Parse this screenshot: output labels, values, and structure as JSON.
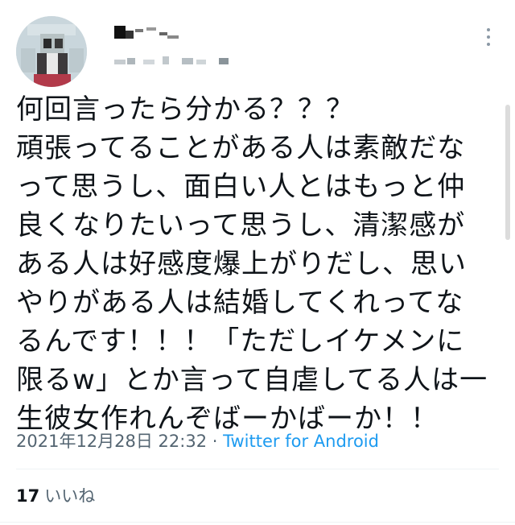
{
  "tweet": {
    "text": "何回言ったら分かる？？？\n頑張ってることがある人は素敵だなって思うし、面白い人とはもっと仲良くなりたいって思うし、清潔感がある人は好感度爆上がりだし、思いやりがある人は結婚してくれってなるんです！！！「ただしイケメンに限るw」とか言って自虐してる人は一生彼女作れんぞばーかばーか！！",
    "timestamp": "2021年12月28日 22:32",
    "separator": "·",
    "source": "Twitter for Android",
    "likes_count": "17",
    "likes_label": "いいね"
  },
  "user": {
    "avatar_icon": "pixelated-avatar-icon",
    "more_icon": "more-vertical-icon"
  },
  "colors": {
    "text": "#0f1419",
    "secondary": "#536471",
    "link": "#1d9bf0",
    "divider": "#eff3f4"
  }
}
